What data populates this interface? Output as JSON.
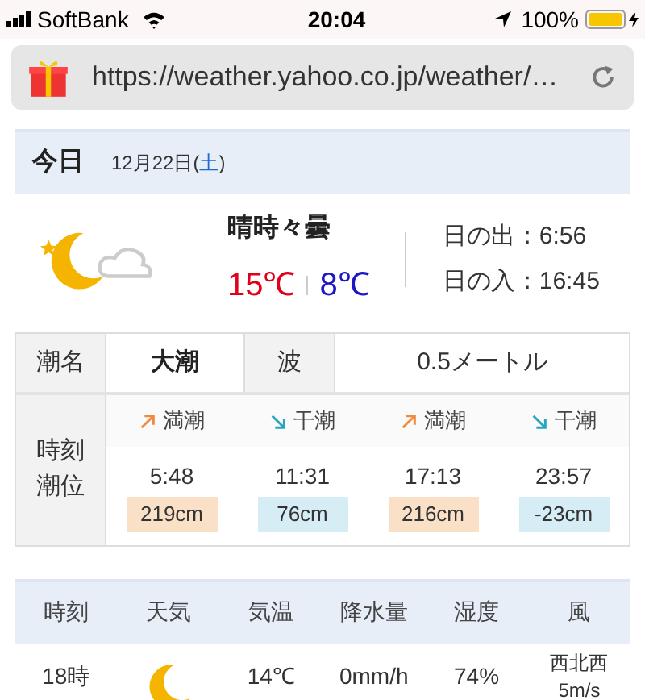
{
  "status_bar": {
    "carrier": "SoftBank",
    "time": "20:04",
    "battery": "100%"
  },
  "address_bar": {
    "url": "https://weather.yahoo.co.jp/weather/…"
  },
  "today": {
    "label": "今日",
    "date_prefix": "12月22日(",
    "weekday": "土",
    "date_suffix": ")",
    "condition": "晴時々曇",
    "high": "15℃",
    "low": "8℃",
    "sunrise": "日の出：6:56",
    "sunset": "日の入：16:45"
  },
  "tide": {
    "name_label": "潮名",
    "name": "大潮",
    "wave_label": "波",
    "wave": "0.5メートル",
    "time_label": "時刻",
    "level_label": "潮位",
    "entries": [
      {
        "kind": "high",
        "label": "満潮",
        "time": "5:48",
        "level_text": "219cm"
      },
      {
        "kind": "low",
        "label": "干潮",
        "time": "11:31",
        "level_text": "76cm"
      },
      {
        "kind": "high",
        "label": "満潮",
        "time": "17:13",
        "level_text": "216cm"
      },
      {
        "kind": "low",
        "label": "干潮",
        "time": "23:57",
        "level_text": "-23cm"
      }
    ]
  },
  "hourly": {
    "columns": [
      "時刻",
      "天気",
      "気温",
      "降水量",
      "湿度",
      "風"
    ],
    "rows": [
      {
        "time": "18時",
        "temp": "14℃",
        "precip": "0mm/h",
        "humidity": "74%",
        "wind_dir": "西北西",
        "wind_speed": "5m/s"
      }
    ]
  }
}
